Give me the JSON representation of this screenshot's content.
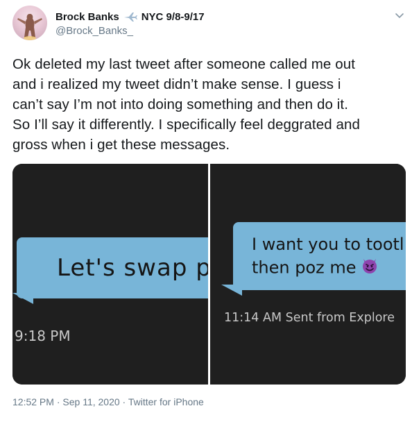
{
  "header": {
    "display_name": "Brock Banks",
    "location_tag": "NYC 9/8-9/17",
    "handle": "@Brock_Banks_",
    "icons": [
      "avatar-image",
      "airplane-emoji",
      "chevron-down-icon"
    ]
  },
  "tweet": {
    "text": "Ok deleted my last tweet after someone called me out\nand i realized my tweet didn’t make sense. I guess i\ncan’t say I’m not into doing something and then do it.\nSo I’ll say it differently. I specifically feel deggrated and\ngross when i get these messages."
  },
  "media": {
    "left_photo": {
      "message": "Let's swap p",
      "timestamp": "9:18 PM"
    },
    "right_photo": {
      "message_line1": "I want you to tootl",
      "message_line2": "then poz me",
      "timestamp": "11:14 AM Sent from Explore",
      "emoji": "smiling-devil-emoji"
    }
  },
  "footer": {
    "time": "12:52 PM",
    "separator": "·",
    "date": "Sep 11, 2020",
    "source": "Twitter for iPhone"
  },
  "colors": {
    "bubble": "#78b5d8",
    "media_bg": "#1f1f1f",
    "secondary_text": "#657786",
    "primary_text": "#14171a"
  }
}
